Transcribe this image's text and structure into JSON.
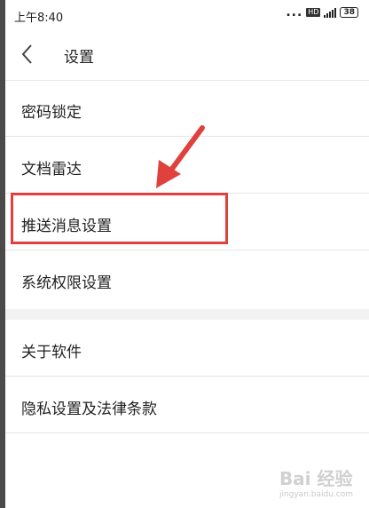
{
  "status_bar": {
    "time": "上午8:40",
    "dots": "...",
    "hd_badge": "HD",
    "battery": "38"
  },
  "nav": {
    "title": "设置"
  },
  "settings": {
    "items": [
      {
        "label": "密码锁定"
      },
      {
        "label": "文档雷达"
      },
      {
        "label": "推送消息设置"
      },
      {
        "label": "系统权限设置"
      },
      {
        "label": "关于软件"
      },
      {
        "label": "隐私设置及法律条款"
      }
    ]
  },
  "annotation": {
    "highlight_color": "#e0413c"
  },
  "watermark": {
    "text": "Bai 经验",
    "sub": "jingyan.baidu.com"
  },
  "icons": {
    "back": "chevron-left-icon",
    "signal": "signal-icon",
    "battery": "battery-icon"
  }
}
